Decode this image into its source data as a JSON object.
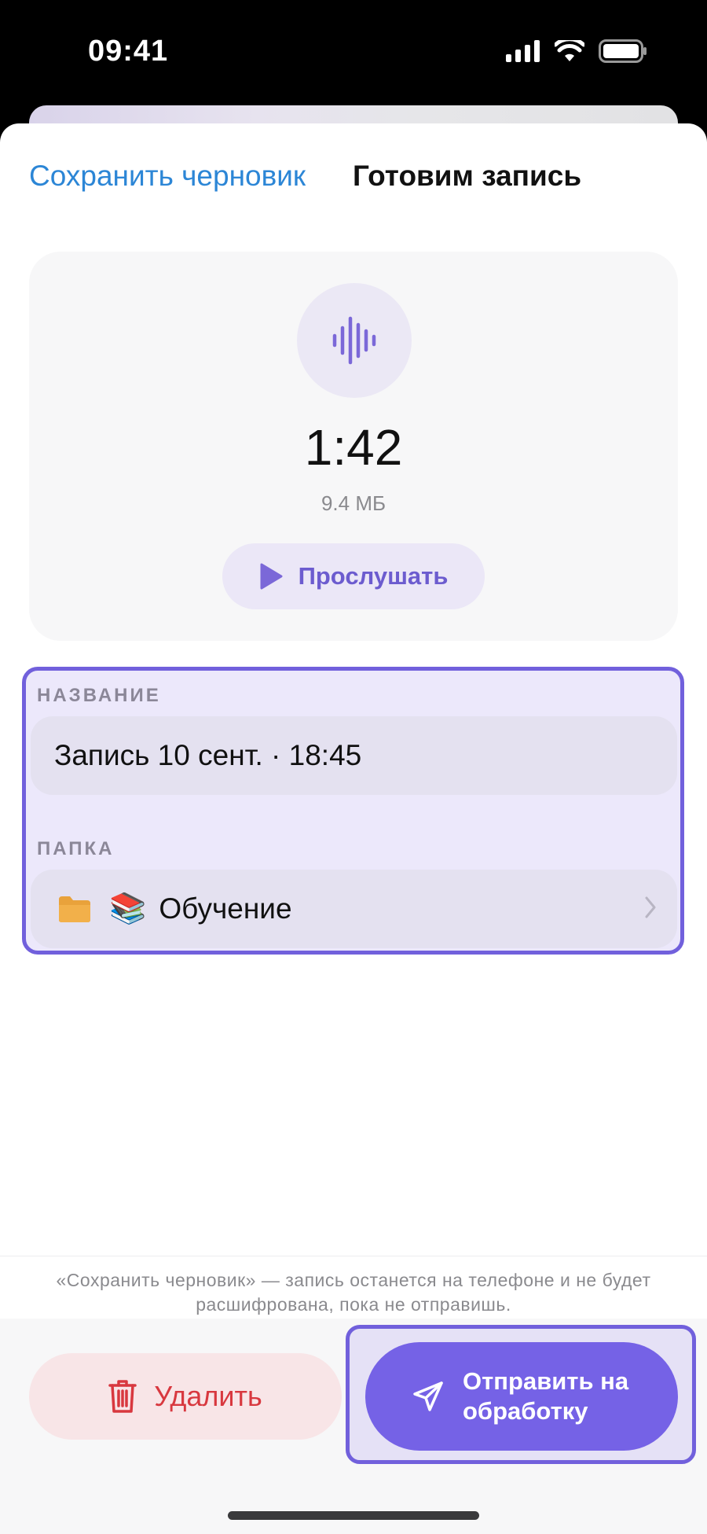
{
  "status_bar": {
    "time": "09:41"
  },
  "nav": {
    "save_draft": "Сохранить черновик",
    "title": "Готовим запись"
  },
  "audio": {
    "icon": "waveform-icon",
    "duration": "1:42",
    "size": "9.4 МБ",
    "listen_label": "Прослушать",
    "listen_icon": "play-icon"
  },
  "form": {
    "name_label": "НАЗВАНИЕ",
    "name_value": "Запись 10 сент. · 18:45",
    "folder_label": "ПАПКА",
    "folder_emoji": "📚",
    "folder_value": "Обучение",
    "folder_icon": "folder-icon"
  },
  "footer": {
    "note": "«Сохранить черновик» — запись останется на телефоне и не будет расшифрована, пока не отправишь.",
    "delete_label": "Удалить",
    "send_label": "Отправить на обработку"
  },
  "colors": {
    "accent": "#7562e6",
    "link": "#2c86d6",
    "danger": "#d8383f",
    "selection_border": "#7160dc"
  }
}
